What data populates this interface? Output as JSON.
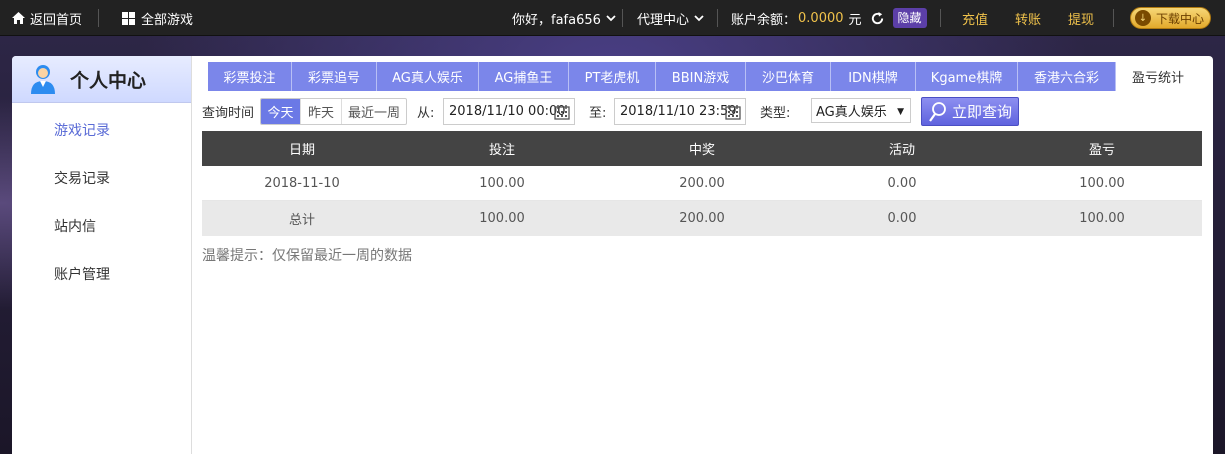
{
  "topbar": {
    "home_label": "返回首页",
    "all_games_label": "全部游戏",
    "greeting": "你好，fafa656",
    "agent_center": "代理中心",
    "balance_label": "账户余额：",
    "balance_value": "0.0000",
    "balance_unit": "元",
    "hide_label": "隐藏",
    "recharge": "充值",
    "transfer": "转账",
    "withdraw": "提现",
    "download": "下载中心"
  },
  "sidebar": {
    "title": "个人中心",
    "items": [
      {
        "label": "游戏记录",
        "active": true
      },
      {
        "label": "交易记录",
        "active": false
      },
      {
        "label": "站内信",
        "active": false
      },
      {
        "label": "账户管理",
        "active": false
      }
    ]
  },
  "tabs": [
    {
      "label": "彩票投注"
    },
    {
      "label": "彩票追号"
    },
    {
      "label": "AG真人娱乐"
    },
    {
      "label": "AG捕鱼王"
    },
    {
      "label": "PT老虎机"
    },
    {
      "label": "BBIN游戏"
    },
    {
      "label": "沙巴体育"
    },
    {
      "label": "IDN棋牌"
    },
    {
      "label": "Kgame棋牌"
    },
    {
      "label": "香港六合彩"
    },
    {
      "label": "盈亏统计",
      "active": true
    }
  ],
  "filter": {
    "query_time_label": "查询时间",
    "ranges": [
      "今天",
      "昨天",
      "最近一周"
    ],
    "from_label": "从:",
    "from_value": "2018/11/10 00:00",
    "to_label": "至:",
    "to_value": "2018/11/10 23:59",
    "type_label": "类型:",
    "type_value": "AG真人娱乐",
    "query_button": "立即查询"
  },
  "table": {
    "headers": [
      "日期",
      "投注",
      "中奖",
      "活动",
      "盈亏"
    ],
    "rows": [
      [
        "2018-11-10",
        "100.00",
        "200.00",
        "0.00",
        "100.00"
      ]
    ],
    "total": [
      "总计",
      "100.00",
      "200.00",
      "0.00",
      "100.00"
    ]
  },
  "tip": "温馨提示：仅保留最近一周的数据",
  "colors": {
    "accent": "#7b86ea",
    "gold": "#f0c24b",
    "table_header": "#444444"
  }
}
